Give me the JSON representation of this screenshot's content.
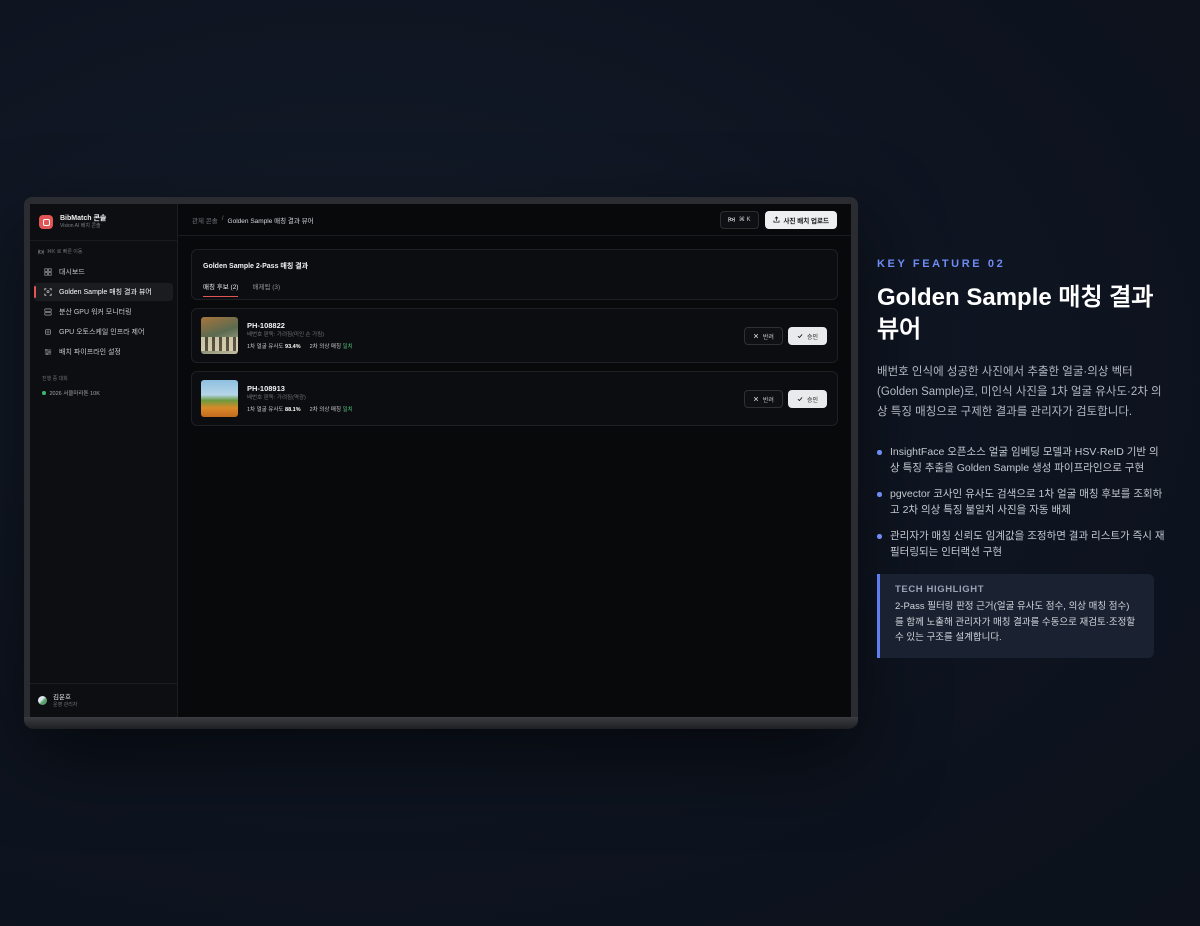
{
  "app": {
    "brand_title": "BibMatch 콘솔",
    "brand_sub": "Vision AI 배치 콘솔",
    "shortcut_hint": "⌘K 로 빠른 이동",
    "nav": [
      {
        "label": "대시보드",
        "icon": "dashboard-icon"
      },
      {
        "label": "Golden Sample 매칭 결과 뷰어",
        "icon": "scan-face-icon",
        "active": true
      },
      {
        "label": "분산 GPU 워커 모니터링",
        "icon": "server-icon"
      },
      {
        "label": "GPU 오토스케일 인프라 제어",
        "icon": "cpu-icon"
      },
      {
        "label": "배치 파이프라인 설정",
        "icon": "sliders-icon"
      }
    ],
    "events_label": "진행 중 대회",
    "events": [
      {
        "label": "2026 서울마라톤 10K"
      }
    ],
    "user": {
      "name": "김운호",
      "role": "운영 관리자"
    },
    "breadcrumb": {
      "root": "관제 콘솔",
      "separator": "/",
      "current": "Golden Sample 매칭 결과 뷰어"
    },
    "actions": {
      "shortcut": "⌘ K",
      "upload": "사진 배치 업로드"
    },
    "panel": {
      "title": "Golden Sample 2-Pass 매칭 결과",
      "tabs": [
        {
          "label": "매칭 후보 (2)",
          "active": true
        },
        {
          "label": "배제됨 (3)"
        }
      ]
    },
    "rows": [
      {
        "id": "PH-108822",
        "sub": "배번호 판독: 가려짐(미인 손 가림)",
        "face_label": "1차 얼굴 유사도",
        "face_score": "93.4%",
        "outfit_label": "2차 의상 매칭",
        "outfit_result": "일치",
        "reject": "반려",
        "approve": "승인"
      },
      {
        "id": "PH-108913",
        "sub": "배번호 판독: 가려짐(역광)",
        "face_label": "1차 얼굴 유사도",
        "face_score": "88.1%",
        "outfit_label": "2차 의상 매칭",
        "outfit_result": "일치",
        "reject": "반려",
        "approve": "승인"
      }
    ]
  },
  "feature": {
    "kicker": "KEY FEATURE 02",
    "headline": "Golden Sample 매칭 결과 뷰어",
    "description": "배번호 인식에 성공한 사진에서 추출한 얼굴·의상 벡터(Golden Sample)로, 미인식 사진을 1차 얼굴 유사도·2차 의상 특징 매칭으로 구제한 결과를 관리자가 검토합니다.",
    "bullets": [
      "InsightFace 오픈소스 얼굴 임베딩 모델과 HSV·ReID 기반 의상 특징 추출을 Golden Sample 생성 파이프라인으로 구현",
      "pgvector 코사인 유사도 검색으로 1차 얼굴 매칭 후보를 조회하고 2차 의상 특징 불일치 사진을 자동 배제",
      "관리자가 매칭 신뢰도 임계값을 조정하면 결과 리스트가 즉시 재필터링되는 인터랙션 구현"
    ],
    "highlight_title": "TECH HIGHLIGHT",
    "highlight_text": "2-Pass 필터링 판정 근거(얼굴 유사도 점수, 의상 매칭 점수)를 함께 노출해 관리자가 매칭 결과를 수동으로 재검토·조정할 수 있는 구조를 설계합니다."
  },
  "colors": {
    "accent": "#e25555",
    "feature_accent": "#6f8cf4",
    "match_ok": "#4cc37d"
  }
}
